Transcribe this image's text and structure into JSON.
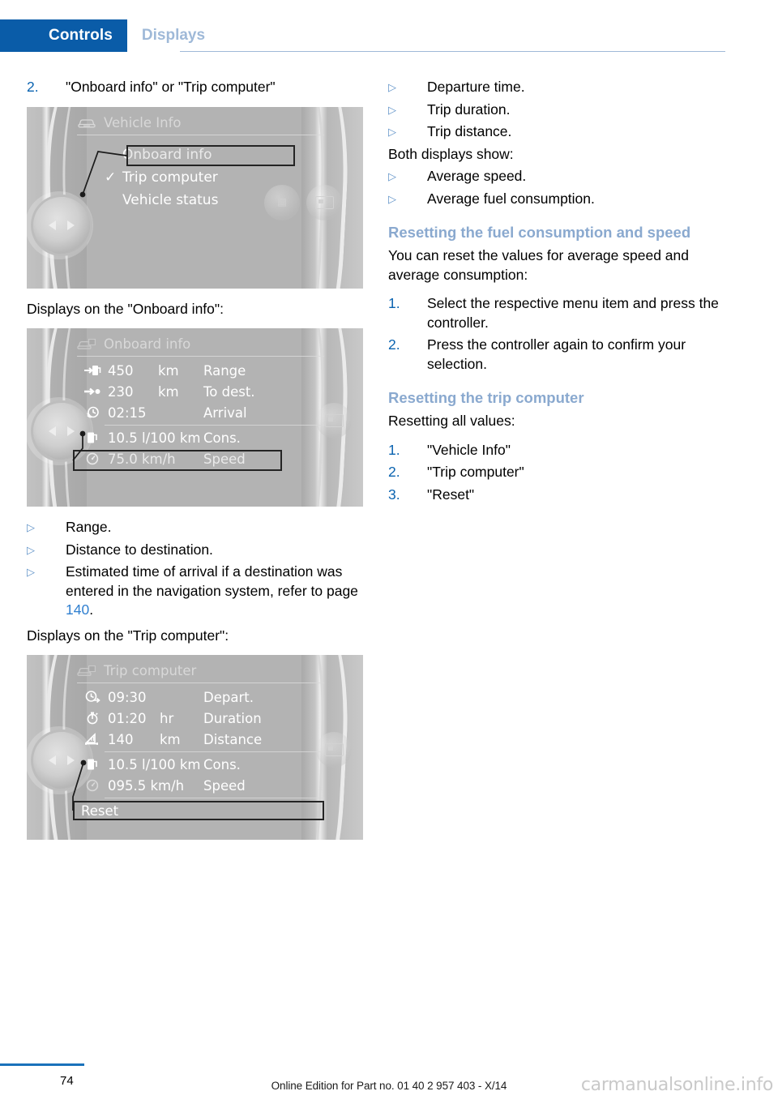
{
  "header": {
    "active_tab": "Controls",
    "inactive_tab": "Displays",
    "accent_color": "#0a5ca8",
    "inactive_color": "#9fb9d8"
  },
  "left_column": {
    "step_2": {
      "marker": "2.",
      "text": "\"Onboard info\" or \"Trip computer\""
    },
    "caption_onboard": "Displays on the \"Onboard info\":",
    "caption_trip": "Displays on the \"Trip computer\":",
    "bullets": [
      {
        "marker": "▷",
        "text": "Range."
      },
      {
        "marker": "▷",
        "text": "Distance to destination."
      },
      {
        "marker": "▷",
        "text_before": "Estimated time of arrival if a destination was entered in the navigation system, refer to page ",
        "page_ref": "140",
        "text_after": "."
      }
    ]
  },
  "right_column": {
    "bullets_top": [
      {
        "marker": "▷",
        "text": "Departure time."
      },
      {
        "marker": "▷",
        "text": "Trip duration."
      },
      {
        "marker": "▷",
        "text": "Trip distance."
      }
    ],
    "both_displays_lead": "Both displays show:",
    "bullets_both": [
      {
        "marker": "▷",
        "text": "Average speed."
      },
      {
        "marker": "▷",
        "text": "Average fuel consumption."
      }
    ],
    "heading_reset_fuel": "Resetting the fuel consumption and speed",
    "para_reset_fuel": "You can reset the values for average speed and average consumption:",
    "steps_reset_fuel": [
      {
        "marker": "1.",
        "text": "Select the respective menu item and press the controller."
      },
      {
        "marker": "2.",
        "text": "Press the controller again to confirm your selection."
      }
    ],
    "heading_reset_trip": "Resetting the trip computer",
    "para_reset_trip": "Resetting all values:",
    "steps_reset_trip": [
      {
        "marker": "1.",
        "text": "\"Vehicle Info\""
      },
      {
        "marker": "2.",
        "text": "\"Trip computer\""
      },
      {
        "marker": "3.",
        "text": "\"Reset\""
      }
    ]
  },
  "figures": {
    "vehicle_info": {
      "screen_title": "Vehicle Info",
      "title_icon": "car-front-icon",
      "menu": [
        {
          "label": "Onboard info",
          "checked": false,
          "highlighted": true
        },
        {
          "label": "Trip computer",
          "checked": true,
          "check_glyph": "✓",
          "highlighted": false
        },
        {
          "label": "Vehicle status",
          "checked": false,
          "highlighted": false
        }
      ],
      "knob_left_glyph": "◀",
      "knob_right_glyph": "▶"
    },
    "onboard_info": {
      "screen_title": "Onboard info",
      "title_icon": "car-info-icon",
      "rows": [
        {
          "icon": "fuel-pump-arrow-icon",
          "value": "450",
          "unit": "km",
          "label": "Range"
        },
        {
          "icon": "arrow-to-dot-icon",
          "value": "230",
          "unit": "km",
          "label": "To dest."
        },
        {
          "icon": "clock-arrival-icon",
          "value": "02:15",
          "unit": "",
          "label": "Arrival"
        },
        {
          "icon": "fuel-pump-icon",
          "value": "10.5 l/100 km",
          "unit": "",
          "label": "Cons.",
          "highlighted": false
        },
        {
          "icon": "speedometer-icon",
          "value": "75.0 km/h",
          "unit": "",
          "label": "Speed",
          "highlighted": true
        }
      ],
      "separator_after_row_index": 2
    },
    "trip_computer": {
      "screen_title": "Trip computer",
      "title_icon": "car-info-icon",
      "rows": [
        {
          "icon": "clock-departure-icon",
          "value": "09:30",
          "unit": "",
          "label": "Depart."
        },
        {
          "icon": "stopwatch-icon",
          "value": "01:20",
          "unit": "hr",
          "label": "Duration"
        },
        {
          "icon": "distance-icon",
          "value": "140",
          "unit": "km",
          "label": "Distance"
        },
        {
          "icon": "fuel-pump-icon",
          "value": "10.5 l/100 km",
          "unit": "",
          "label": "Cons."
        },
        {
          "icon": "speedometer-icon",
          "value": "095.5 km/h",
          "unit": "",
          "label": "Speed"
        }
      ],
      "separator_after_row_index": 2,
      "reset_label": "Reset"
    }
  },
  "footer": {
    "page_number": "74",
    "edition_note": "Online Edition for Part no. 01 40 2 957 403 - X/14",
    "watermark": "carmanualsonline.info"
  }
}
